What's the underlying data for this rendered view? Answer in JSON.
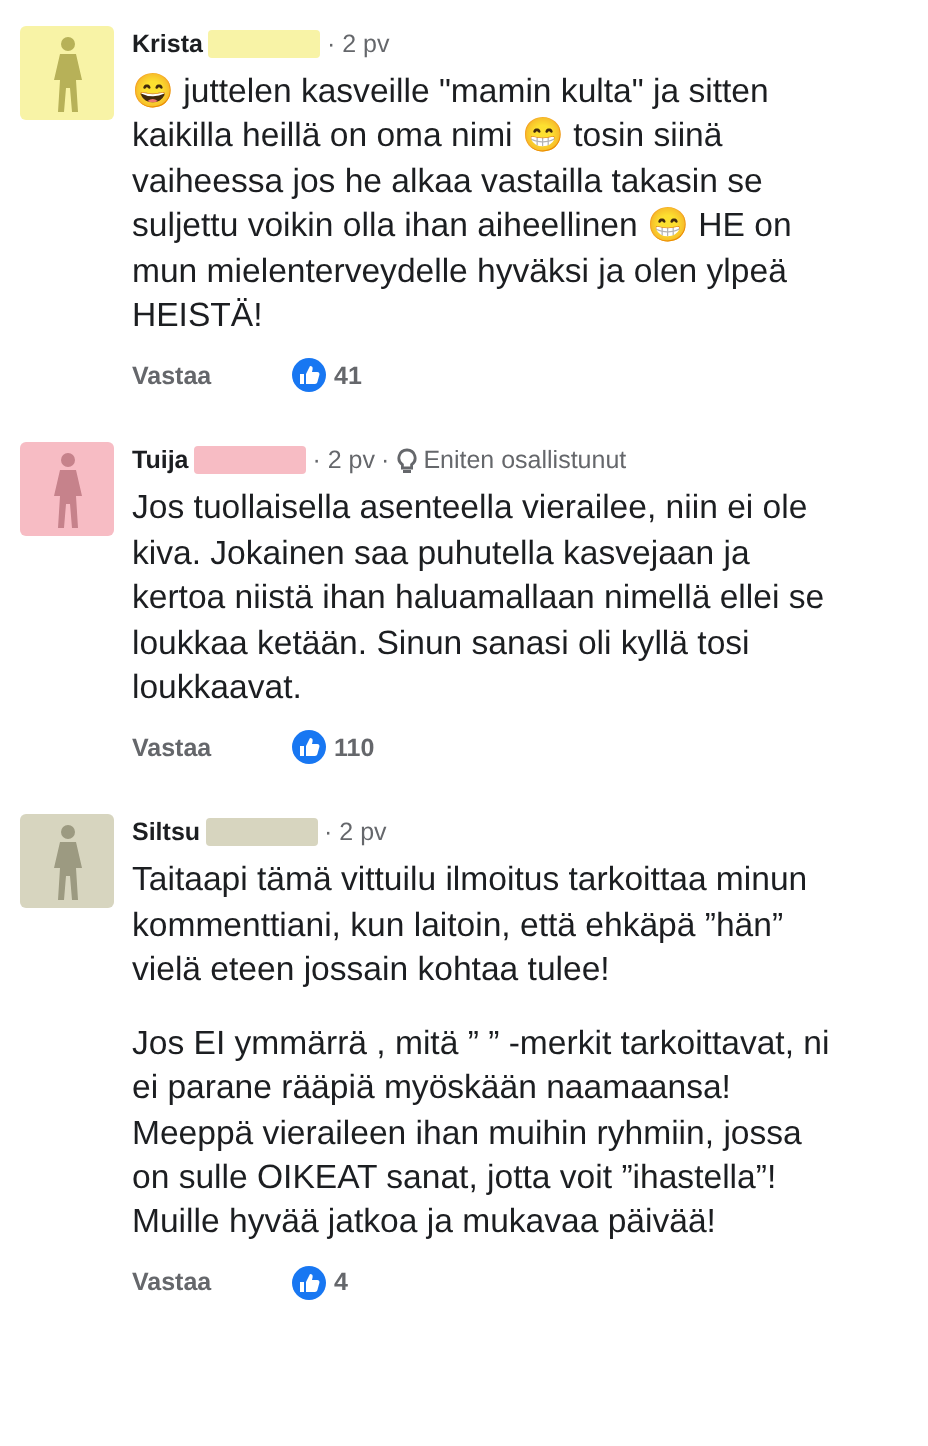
{
  "comments": [
    {
      "author": "Krista",
      "color": "#f8f3a6",
      "time": "· 2 pv",
      "paragraphs": [
        "😄 juttelen kasveille \"mamin kulta\" ja sitten kaikilla heillä on oma nimi 😁 tosin siinä vaiheessa jos he alkaa vastailla takasin se suljettu voikin olla ihan aiheellinen 😁 HE on mun mielenterveydelle hyväksi ja olen ylpeä HEISTÄ!"
      ],
      "reply": "Vastaa",
      "likes": "41"
    },
    {
      "author": "Tuija",
      "color": "#f7bcc4",
      "time": "· 2 pv",
      "badge": {
        "separator": "·",
        "label": "Eniten osallistunut"
      },
      "paragraphs": [
        "Jos tuollaisella asenteella vierailee, niin ei ole kiva. Jokainen saa puhutella kasvejaan ja kertoa niistä ihan haluamallaan nimellä ellei se loukkaa ketään. Sinun sanasi oli kyllä tosi loukkaavat."
      ],
      "reply": "Vastaa",
      "likes": "110"
    },
    {
      "author": "Siltsu",
      "color": "#d7d5bf",
      "time": "· 2 pv",
      "paragraphs": [
        "Taitaapi tämä vittuilu ilmoitus tarkoittaa minun kommenttiani, kun laitoin, että ehkäpä ”hän” vielä eteen jossain kohtaa tulee!",
        "Jos EI ymmärrä , mitä ” ” -merkit tarkoittavat, ni ei parane rääpiä myöskään naamaansa! Meeppä vieraileen ihan muihin ryhmiin, jossa on sulle OIKEAT sanat, jotta voit ”ihastella”! Muille hyvää jatkoa ja mukavaa päivää!"
      ],
      "reply": "Vastaa",
      "likes": "4"
    }
  ]
}
